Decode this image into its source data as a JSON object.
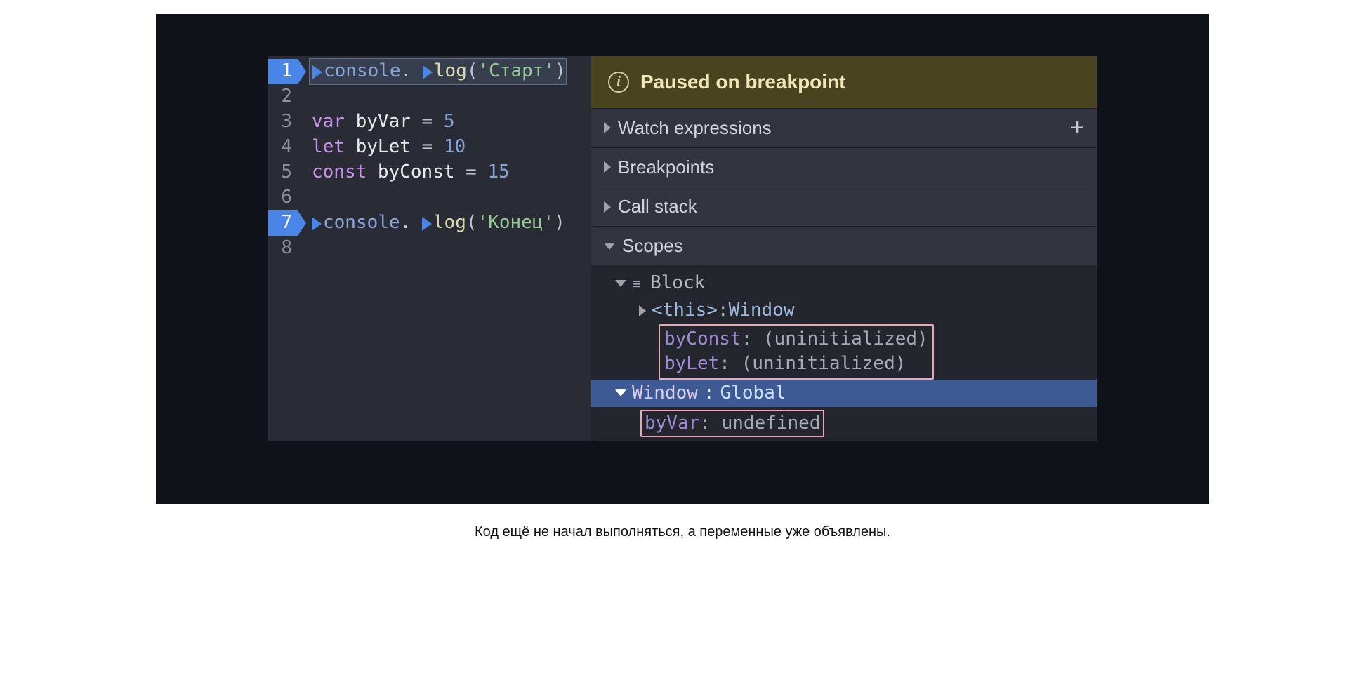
{
  "code": {
    "lines": [
      {
        "num": "1",
        "bp": true,
        "active": true,
        "tokens": [
          {
            "step": true
          },
          {
            "t": "obj",
            "v": "console"
          },
          {
            "t": "punc",
            "v": ". "
          },
          {
            "step": true
          },
          {
            "t": "fn",
            "v": "log"
          },
          {
            "t": "punc",
            "v": "("
          },
          {
            "t": "str",
            "v": "'Старт'"
          },
          {
            "t": "punc",
            "v": ")"
          }
        ]
      },
      {
        "num": "2",
        "bp": false,
        "tokens": []
      },
      {
        "num": "3",
        "bp": false,
        "tokens": [
          {
            "t": "kw",
            "v": "var "
          },
          {
            "t": "var",
            "v": "byVar"
          },
          {
            "t": "punc",
            "v": " = "
          },
          {
            "t": "num",
            "v": "5"
          }
        ]
      },
      {
        "num": "4",
        "bp": false,
        "tokens": [
          {
            "t": "kw",
            "v": "let "
          },
          {
            "t": "var",
            "v": "byLet"
          },
          {
            "t": "punc",
            "v": " = "
          },
          {
            "t": "num",
            "v": "10"
          }
        ]
      },
      {
        "num": "5",
        "bp": false,
        "tokens": [
          {
            "t": "kw",
            "v": "const "
          },
          {
            "t": "var",
            "v": "byConst"
          },
          {
            "t": "punc",
            "v": " = "
          },
          {
            "t": "num",
            "v": "15"
          }
        ]
      },
      {
        "num": "6",
        "bp": false,
        "tokens": []
      },
      {
        "num": "7",
        "bp": true,
        "tokens": [
          {
            "step": true
          },
          {
            "t": "obj",
            "v": "console"
          },
          {
            "t": "punc",
            "v": ". "
          },
          {
            "step": true
          },
          {
            "t": "fn",
            "v": "log"
          },
          {
            "t": "punc",
            "v": "("
          },
          {
            "t": "str",
            "v": "'Конец'"
          },
          {
            "t": "punc",
            "v": ")"
          }
        ]
      },
      {
        "num": "8",
        "bp": false,
        "tokens": []
      }
    ]
  },
  "debugger": {
    "paused_label": "Paused on breakpoint",
    "sections": {
      "watch": "Watch expressions",
      "breakpoints": "Breakpoints",
      "callstack": "Call stack",
      "scopes": "Scopes"
    },
    "scopes": {
      "block_label": "Block",
      "this_label": "<this>",
      "this_value": "Window",
      "block_vars": [
        {
          "k": "byConst",
          "v": "(uninitialized)"
        },
        {
          "k": "byLet",
          "v": "(uninitialized)"
        }
      ],
      "global_key": "Window",
      "global_type": "Global",
      "global_vars": [
        {
          "k": "byVar",
          "v": "undefined"
        }
      ]
    }
  },
  "caption": "Код ещё не начал выполняться, а переменные уже объявлены."
}
